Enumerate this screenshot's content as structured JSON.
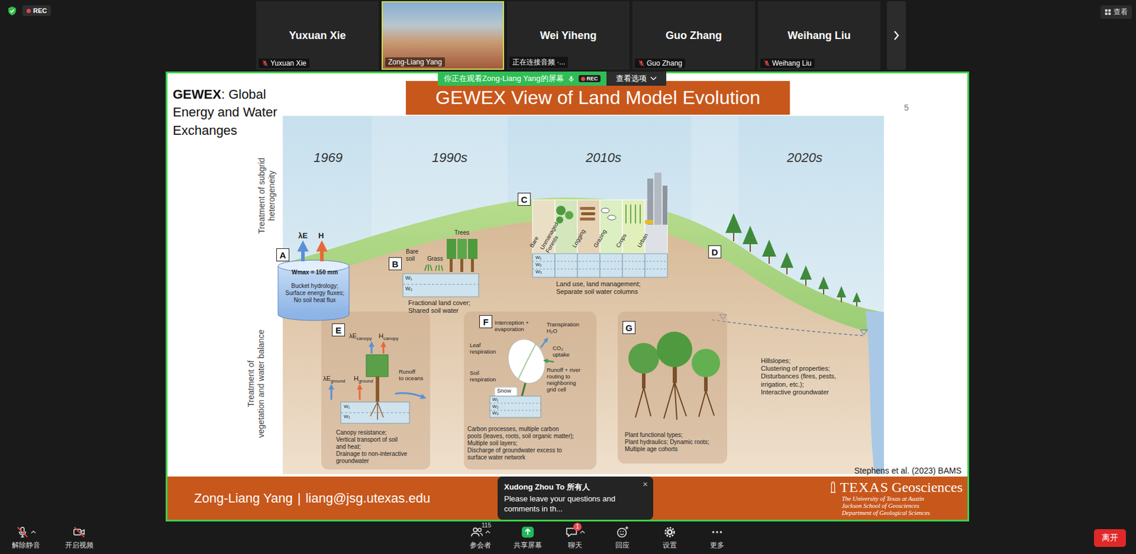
{
  "meeting": {
    "recording": true,
    "rec_label": "REC",
    "view_button": "查看"
  },
  "participants": [
    {
      "name": "Yuxuan Xie",
      "tag": "Yuxuan Xie",
      "muted": true,
      "video": false,
      "speaking": false
    },
    {
      "tag": "Zong-Liang Yang",
      "muted": false,
      "video": true,
      "speaking": true
    },
    {
      "name": "Wei Yiheng",
      "tag": "正在连接音频 ·...",
      "muted": false,
      "video": false,
      "speaking": false
    },
    {
      "name": "Guo Zhang",
      "tag": "Guo Zhang",
      "muted": true,
      "video": false,
      "speaking": false
    },
    {
      "name": "Weihang Liu",
      "tag": "Weihang Liu",
      "muted": true,
      "video": false,
      "speaking": false
    }
  ],
  "share_banner": {
    "text": "你正在观看Zong-Liang Yang的屏幕",
    "rec": "REC",
    "view_options": "查看选项"
  },
  "slide": {
    "heading": {
      "bold": "GEWEX",
      "rest": ": Global Energy and Water Exchanges"
    },
    "title": "GEWEX View of Land Model Evolution",
    "page": "5",
    "eras": [
      "1969",
      "1990s",
      "2010s",
      "2020s"
    ],
    "axes": [
      [
        "Treatment of subgrid",
        "heterogeneity"
      ],
      [
        "Treatment of",
        "vegetation and water balance"
      ]
    ],
    "stages": [
      {
        "letter": "A",
        "caption": [
          "Bucket hydrology;",
          "Surface energy fluxes;",
          "No soil heat flux"
        ],
        "labels": [
          {
            "lines": [
              "λE"
            ]
          },
          {
            "lines": [
              "H"
            ]
          },
          {
            "lines": [
              "Wmax = 150 mm"
            ]
          }
        ]
      },
      {
        "letter": "B",
        "caption": [
          "Fractional land cover;",
          "Shared soil water"
        ],
        "labels": [
          {
            "lines": [
              "Bare",
              "soil"
            ]
          },
          {
            "lines": [
              "Grass"
            ]
          },
          {
            "lines": [
              "Trees"
            ]
          },
          {
            "lines": [
              "W₁"
            ]
          },
          {
            "lines": [
              "W₂"
            ]
          }
        ]
      },
      {
        "letter": "C",
        "caption": [
          "Land use, land management;",
          "Separate soil water columns"
        ],
        "labels": [
          {
            "lines": [
              "Bare"
            ]
          },
          {
            "lines": [
              "Unmanaged",
              "Forests"
            ]
          },
          {
            "lines": [
              "Logging"
            ]
          },
          {
            "lines": [
              "Grazing"
            ]
          },
          {
            "lines": [
              "Crops"
            ]
          },
          {
            "lines": [
              "Urban"
            ]
          },
          {
            "lines": [
              "W₁"
            ]
          },
          {
            "lines": [
              "W₂"
            ]
          },
          {
            "lines": [
              "W₃"
            ]
          }
        ]
      },
      {
        "letter": "D",
        "caption": [
          "Hillslopes;",
          "Clustering of properties;",
          "Disturbances (fires, pests,",
          "irrigation, etc.);",
          "Interactive groundwater"
        ],
        "labels": []
      },
      {
        "letter": "E",
        "caption": [
          "Canopy resistance;",
          "Vertical transport of soil",
          "and heat;",
          "Drainage to non-interactive",
          "groundwater"
        ],
        "labels": [
          {
            "lines": [
              "λE"
            ],
            "sub": "canopy"
          },
          {
            "lines": [
              "H"
            ],
            "sub": "canopy"
          },
          {
            "lines": [
              "λE"
            ],
            "sub": "ground"
          },
          {
            "lines": [
              "H"
            ],
            "sub": "ground"
          },
          {
            "lines": [
              "Runoff",
              "to oceans"
            ]
          },
          {
            "lines": [
              "W₁"
            ]
          },
          {
            "lines": [
              "W₂"
            ]
          }
        ]
      },
      {
        "letter": "F",
        "caption": [
          "Carbon processes, multiple carbon",
          "pools (leaves, roots, soil organic matter);",
          "Multiple soil layers;",
          "Discharge of groundwater excess to",
          "surface water network"
        ],
        "labels": [
          {
            "lines": [
              "Interception +",
              "evaporation"
            ]
          },
          {
            "lines": [
              "Transpiration",
              "H₂O"
            ]
          },
          {
            "lines": [
              "Leaf",
              "respiration"
            ]
          },
          {
            "lines": [
              "CO₂",
              "uptake"
            ]
          },
          {
            "lines": [
              "Soil",
              "respiration"
            ]
          },
          {
            "lines": [
              "Snow"
            ]
          },
          {
            "lines": [
              "Runoff + river",
              "routing to",
              "neighboring",
              "grid cell"
            ]
          },
          {
            "lines": [
              "W₁"
            ]
          },
          {
            "lines": [
              "W₂"
            ]
          },
          {
            "lines": [
              "W₃"
            ]
          }
        ]
      },
      {
        "letter": "G",
        "caption": [
          "Plant functional types;",
          "Plant hydraulics; Dynamic roots;",
          "Multiple age cohorts"
        ],
        "labels": []
      }
    ],
    "citation": "Stephens et al. (2023) BAMS",
    "footer": {
      "author": "Zong-Liang Yang",
      "separator": "|",
      "email": "liang@jsg.utexas.edu"
    },
    "logo": {
      "word1": "TEXAS",
      "word2": "Geosciences",
      "lines": [
        "The University of Texas at Austin",
        "Jackson School of Geosciences",
        "Department of Geological Sciences"
      ]
    }
  },
  "toast": {
    "title": "Xudong Zhou To 所有人",
    "message": "Please leave your questions and comments in th...",
    "close": "×"
  },
  "toolbar": {
    "left_items": [
      {
        "kind": "mic",
        "label": "解除静音",
        "off": true,
        "caret": true
      },
      {
        "kind": "video",
        "label": "开启视频",
        "off": true,
        "caret": false
      }
    ],
    "center_items": [
      {
        "kind": "participants",
        "label": "参会者",
        "count": "115",
        "off": false,
        "caret": true
      },
      {
        "kind": "share",
        "label": "共享屏幕",
        "off": false,
        "caret": false
      },
      {
        "kind": "chat",
        "label": "聊天",
        "badge": "1",
        "off": false,
        "caret": true
      },
      {
        "kind": "reactions",
        "label": "回应",
        "off": false,
        "caret": false
      },
      {
        "kind": "settings",
        "label": "设置",
        "off": false,
        "caret": false
      },
      {
        "kind": "more",
        "label": "更多",
        "off": false,
        "caret": false
      }
    ],
    "leave": "离开"
  }
}
